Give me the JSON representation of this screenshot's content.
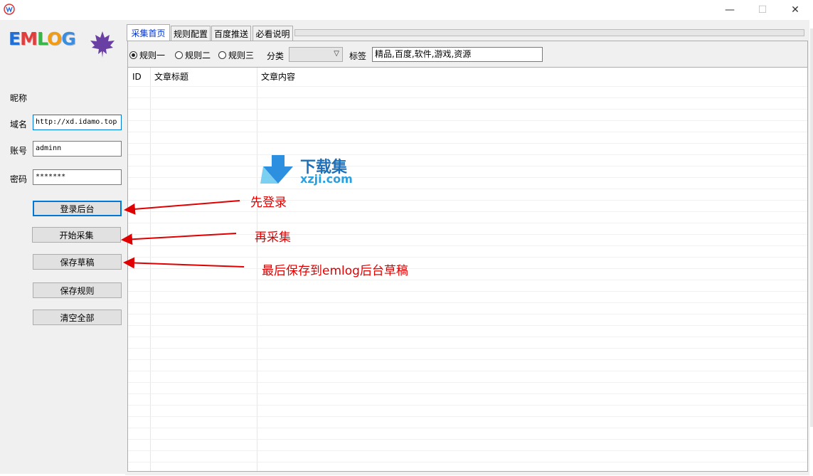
{
  "window": {
    "title": "",
    "minimize_glyph": "—",
    "maximize_glyph": "☐",
    "close_glyph": "✕"
  },
  "logo": {
    "letters": [
      "E",
      "M",
      "L",
      "O",
      "G"
    ],
    "colors": [
      "#1f6fd6",
      "#e23c3c",
      "#39b54a",
      "#f39c12",
      "#3b8de0"
    ],
    "leaf_color": "#6a3fa3"
  },
  "form": {
    "nickname_label": "昵称",
    "domain_label": "域名",
    "domain_value": "http://xd.idamo.top",
    "account_label": "账号",
    "account_value": "adminn",
    "password_label": "密码",
    "password_value": "*******"
  },
  "buttons": {
    "login": "登录后台",
    "start": "开始采集",
    "save_draft": "保存草稿",
    "save_rules": "保存规则",
    "clear_all": "清空全部"
  },
  "tabs": [
    {
      "label": "采集首页",
      "active": true
    },
    {
      "label": "规则配置",
      "active": false
    },
    {
      "label": "百度推送",
      "active": false
    },
    {
      "label": "必看说明",
      "active": false
    }
  ],
  "toolbar": {
    "rules": [
      {
        "label": "规则一",
        "checked": true
      },
      {
        "label": "规则二",
        "checked": false
      },
      {
        "label": "规则三",
        "checked": false
      }
    ],
    "category_label": "分类",
    "category_value": "",
    "tags_label": "标签",
    "tags_value": "精品,百度,软件,游戏,资源"
  },
  "table": {
    "columns": [
      "ID",
      "文章标题",
      "文章内容"
    ]
  },
  "watermark": {
    "name": "下载集",
    "domain": "xzji.com"
  },
  "annotations": {
    "first": "先登录",
    "second": "再采集",
    "third": "最后保存到emlog后台草稿",
    "color": "#e00000"
  }
}
